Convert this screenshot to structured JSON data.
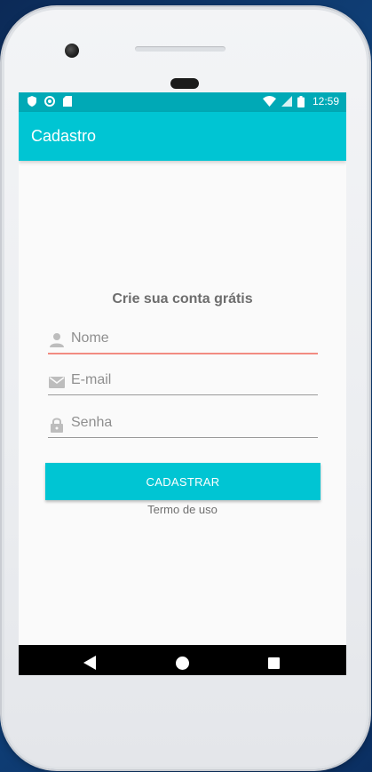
{
  "status_bar": {
    "time": "12:59",
    "icons": [
      "shield-icon",
      "sync-icon",
      "sd-card-icon",
      "wifi-icon",
      "signal-icon",
      "battery-icon"
    ]
  },
  "app_bar": {
    "title": "Cadastro"
  },
  "form": {
    "heading": "Crie sua conta grátis",
    "name_placeholder": "Nome",
    "email_placeholder": "E-mail",
    "password_placeholder": "Senha",
    "submit_label": "CADASTRAR",
    "terms_label": "Termo de uso"
  },
  "nav_bar": {
    "icons": [
      "back-icon",
      "home-icon",
      "recents-icon"
    ]
  },
  "colors": {
    "status_bar": "#00a9b6",
    "primary": "#00c5d3",
    "focus_underline": "#f28b82",
    "screen_bg": "#fafafa"
  }
}
